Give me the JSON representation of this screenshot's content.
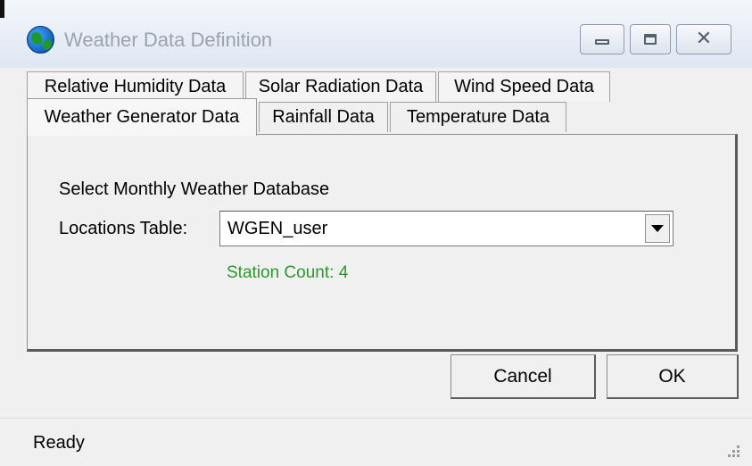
{
  "window": {
    "title": "Weather Data Definition",
    "icon": "globe-icon",
    "controls": [
      "minimize-icon",
      "maximize-icon",
      "close-icon"
    ]
  },
  "tabs": {
    "back_row": [
      {
        "label": "Relative Humidity Data"
      },
      {
        "label": "Solar Radiation Data"
      },
      {
        "label": "Wind Speed Data"
      }
    ],
    "front_row": [
      {
        "label": "Weather Generator Data",
        "active": true
      },
      {
        "label": "Rainfall Data"
      },
      {
        "label": "Temperature Data"
      }
    ]
  },
  "panel": {
    "heading": "Select Monthly Weather Database",
    "locations_label": "Locations Table:",
    "locations_value": "WGEN_user",
    "station_count": "Station Count: 4",
    "station_count_color": "#2a9a2a"
  },
  "buttons": {
    "cancel": "Cancel",
    "ok": "OK"
  },
  "status": {
    "text": "Ready"
  }
}
